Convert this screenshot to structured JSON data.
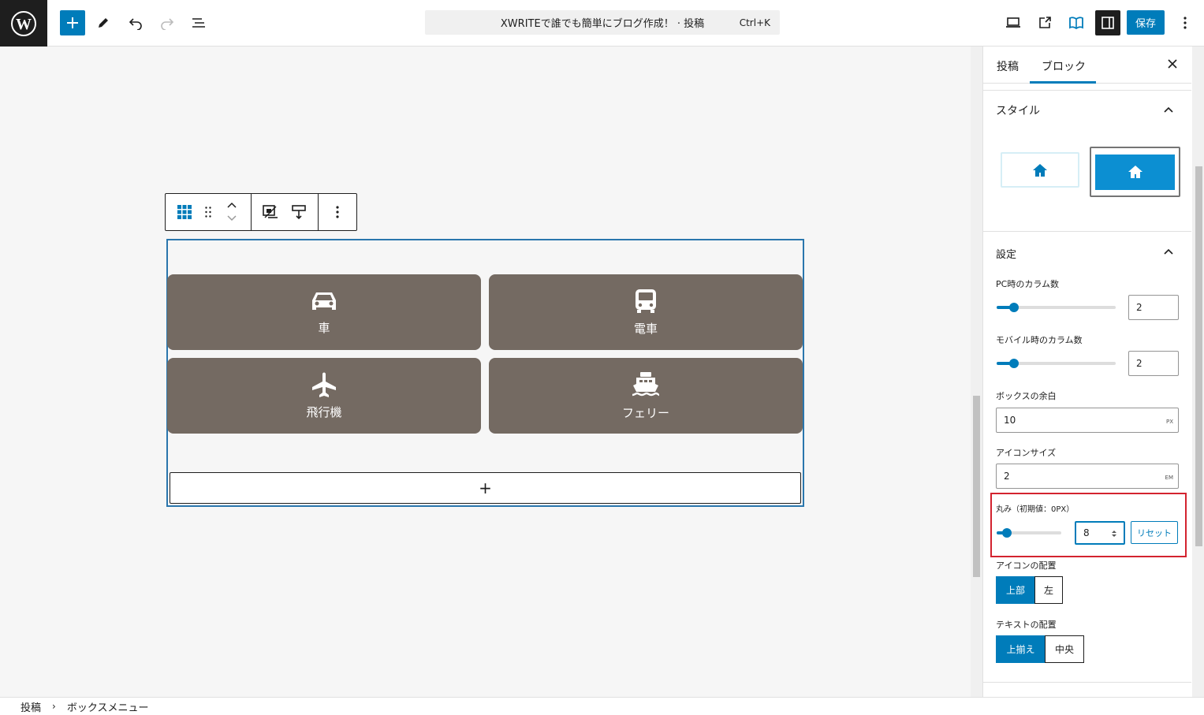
{
  "header": {
    "title": "XWRITEで誰でも簡単にブログ作成！ · 投稿",
    "shortcut": "Ctrl+K",
    "save_label": "保存"
  },
  "canvas": {
    "items": [
      {
        "label": "車",
        "icon": "car-icon"
      },
      {
        "label": "電車",
        "icon": "bus-icon"
      },
      {
        "label": "飛行機",
        "icon": "airplane-icon"
      },
      {
        "label": "フェリー",
        "icon": "ferry-icon"
      }
    ],
    "appender_label": "+"
  },
  "footer": {
    "breadcrumb": [
      "投稿",
      "ボックスメニュー"
    ]
  },
  "sidebar": {
    "tabs": [
      "投稿",
      "ブロック"
    ],
    "active_tab": "ブロック",
    "style_panel": {
      "title": "スタイル"
    },
    "settings_panel": {
      "title": "設定",
      "pc_columns": {
        "label": "PC時のカラム数",
        "value": "2"
      },
      "mobile_columns": {
        "label": "モバイル時のカラム数",
        "value": "2"
      },
      "box_padding": {
        "label": "ボックスの余白",
        "value": "10",
        "unit": "PX"
      },
      "icon_size": {
        "label": "アイコンサイズ",
        "value": "2",
        "unit": "EM"
      },
      "radius": {
        "label": "丸み（初期値：0PX）",
        "value": "8",
        "reset_label": "リセット"
      },
      "icon_position": {
        "label": "アイコンの配置",
        "options": [
          "上部",
          "左"
        ],
        "active": "上部"
      },
      "text_align": {
        "label": "テキストの配置",
        "options": [
          "上揃え",
          "中央"
        ],
        "active": "上揃え"
      }
    }
  },
  "colors": {
    "accent": "#007cba",
    "box": "#746a62",
    "highlight": "#d3232f"
  }
}
